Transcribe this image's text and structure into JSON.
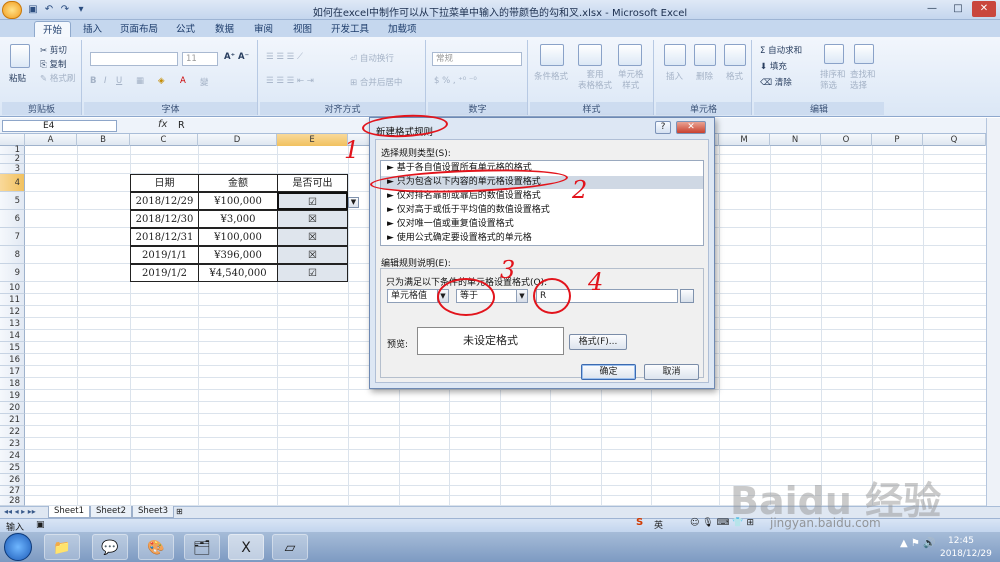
{
  "window": {
    "title": "如何在excel中制作可以从下拉菜单中输入的带颜色的勾和叉.xlsx - Microsoft Excel",
    "minimize": "—",
    "maximize": "□",
    "close": "✕"
  },
  "tabs": [
    "开始",
    "插入",
    "页面布局",
    "公式",
    "数据",
    "审阅",
    "视图",
    "开发工具",
    "加载项"
  ],
  "ribbon": {
    "clipboard": {
      "paste": "粘贴",
      "cut": "剪切",
      "copy": "复制",
      "format_painter": "格式刷",
      "label": "剪贴板"
    },
    "font": {
      "size": "11",
      "label": "字体"
    },
    "alignment": {
      "wrap": "自动换行",
      "merge": "合并后居中",
      "label": "对齐方式"
    },
    "number": {
      "format": "常规",
      "label": "数字"
    },
    "styles": {
      "conditional": "条件格式",
      "table": "套用\n表格格式",
      "cell_styles": "单元格\n样式",
      "label": "样式"
    },
    "cells": {
      "insert": "插入",
      "delete": "删除",
      "format": "格式",
      "label": "单元格"
    },
    "editing": {
      "autosum": "自动求和",
      "fill": "填充",
      "clear": "清除",
      "sort": "排序和\n筛选",
      "find": "查找和\n选择",
      "label": "编辑"
    }
  },
  "formula_bar": {
    "name_box": "E4",
    "fx": "fx",
    "value": "R"
  },
  "columns": [
    "A",
    "B",
    "C",
    "D",
    "E",
    "F",
    "G",
    "H",
    "I",
    "J",
    "K",
    "L",
    "M",
    "N",
    "O",
    "P",
    "Q"
  ],
  "rows": [
    "1",
    "2",
    "3",
    "4",
    "5",
    "6",
    "7",
    "8",
    "9",
    "10",
    "11",
    "12",
    "13",
    "14",
    "15",
    "16",
    "17",
    "18",
    "19",
    "20",
    "21",
    "22",
    "23",
    "24",
    "25",
    "26",
    "27",
    "28"
  ],
  "table": {
    "headers": [
      "日期",
      "金额",
      "是否可出"
    ],
    "rows": [
      [
        "2018/12/29",
        "¥100,000",
        "☑"
      ],
      [
        "2018/12/30",
        "¥3,000",
        "☒"
      ],
      [
        "2018/12/31",
        "¥100,000",
        "☒"
      ],
      [
        "2019/1/1",
        "¥396,000",
        "☒"
      ],
      [
        "2019/1/2",
        "¥4,540,000",
        "☑"
      ]
    ]
  },
  "sheets": [
    "Sheet1",
    "Sheet2",
    "Sheet3"
  ],
  "status": {
    "mode": "输入"
  },
  "dialog": {
    "title": "新建格式规则",
    "help": "?",
    "close": "✕",
    "select_rule_label": "选择规则类型(S):",
    "rules": [
      "► 基于各自值设置所有单元格的格式",
      "► 只为包含以下内容的单元格设置格式",
      "► 仅对排名靠前或靠后的数值设置格式",
      "► 仅对高于或低于平均值的数值设置格式",
      "► 仅对唯一值或重复值设置格式",
      "► 使用公式确定要设置格式的单元格"
    ],
    "edit_label": "编辑规则说明(E):",
    "condition_label": "只为满足以下条件的单元格设置格式(O):",
    "cond1": "单元格值",
    "cond2": "等于",
    "cond_value": "R",
    "preview_label": "预览:",
    "preview_text": "未设定格式",
    "format_button": "格式(F)...",
    "ok": "确定",
    "cancel": "取消"
  },
  "annotations": [
    "1",
    "2",
    "3",
    "4"
  ],
  "watermark": {
    "main": "Baidu 经验",
    "sub": "jingyan.baidu.com"
  },
  "taskbar": {
    "ime": "英",
    "time": "12:45",
    "date": "2018/12/29"
  }
}
